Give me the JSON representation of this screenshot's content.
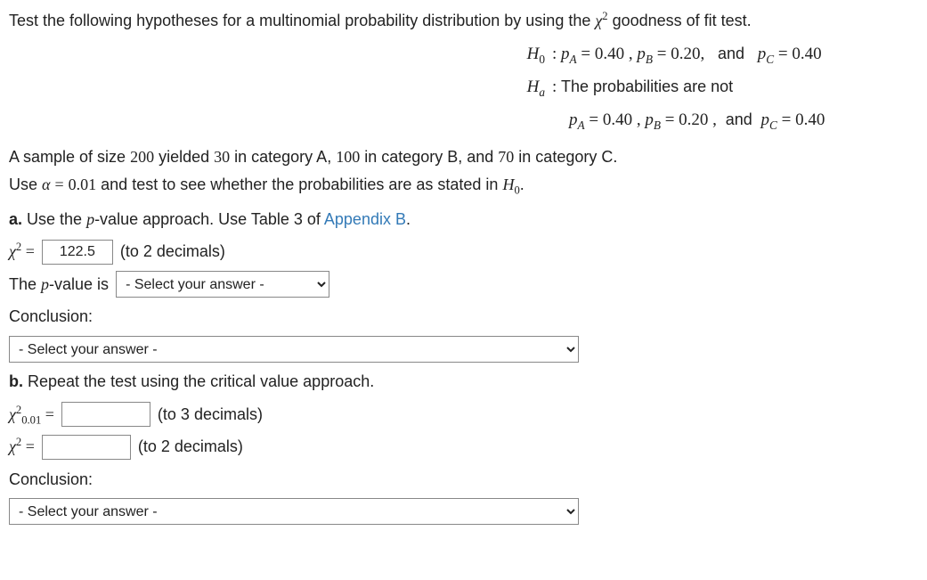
{
  "intro_pre": "Test the following hypotheses for a multinomial probability distribution by using the ",
  "intro_chi": "χ",
  "intro_chi_exp": "2",
  "intro_post": " goodness of fit test.",
  "h0_label": "H",
  "h0_sub": "0",
  "colon": " : ",
  "h0_body_html": "p_A = 0.40 , p_B = 0.20,  and  p_C = 0.40",
  "ha_label": "H",
  "ha_sub": "a",
  "ha_body_text": "The probabilities are not",
  "ha_body2": "p_A = 0.40 , p_B = 0.20 , and  p_C = 0.40",
  "sample_pre": "A sample of size ",
  "sample_n": "200",
  "sample_mid1": " yielded ",
  "sample_a": "30",
  "sample_mid2": " in category A, ",
  "sample_b": "100",
  "sample_mid3": " in category B, and ",
  "sample_c": "70",
  "sample_mid4": " in category C.",
  "use_alpha_pre": "Use ",
  "alpha": "α",
  "alpha_val": "0.01",
  "use_alpha_mid": " and test to see whether the probabilities are as stated in ",
  "h0_ref": "H",
  "h0_ref_sub": "0",
  "period": ".",
  "a_label": "a.",
  "a_text_pre": " Use the ",
  "a_p": "p",
  "a_text_mid": "-value approach. Use Table 3 of ",
  "appendix": "Appendix B",
  "chi": "χ",
  "exp2": "2",
  "equals": " = ",
  "chi2_value": "122.5",
  "to2dec": "(to 2 decimals)",
  "to3dec": "(to 3 decimals)",
  "pval_pre": "The ",
  "pval_mid": "-value is",
  "select_placeholder": "- Select your answer -",
  "conclusion": "Conclusion:",
  "b_label": "b.",
  "b_text": " Repeat the test using the critical value approach.",
  "chi_crit_sub": "0.01"
}
